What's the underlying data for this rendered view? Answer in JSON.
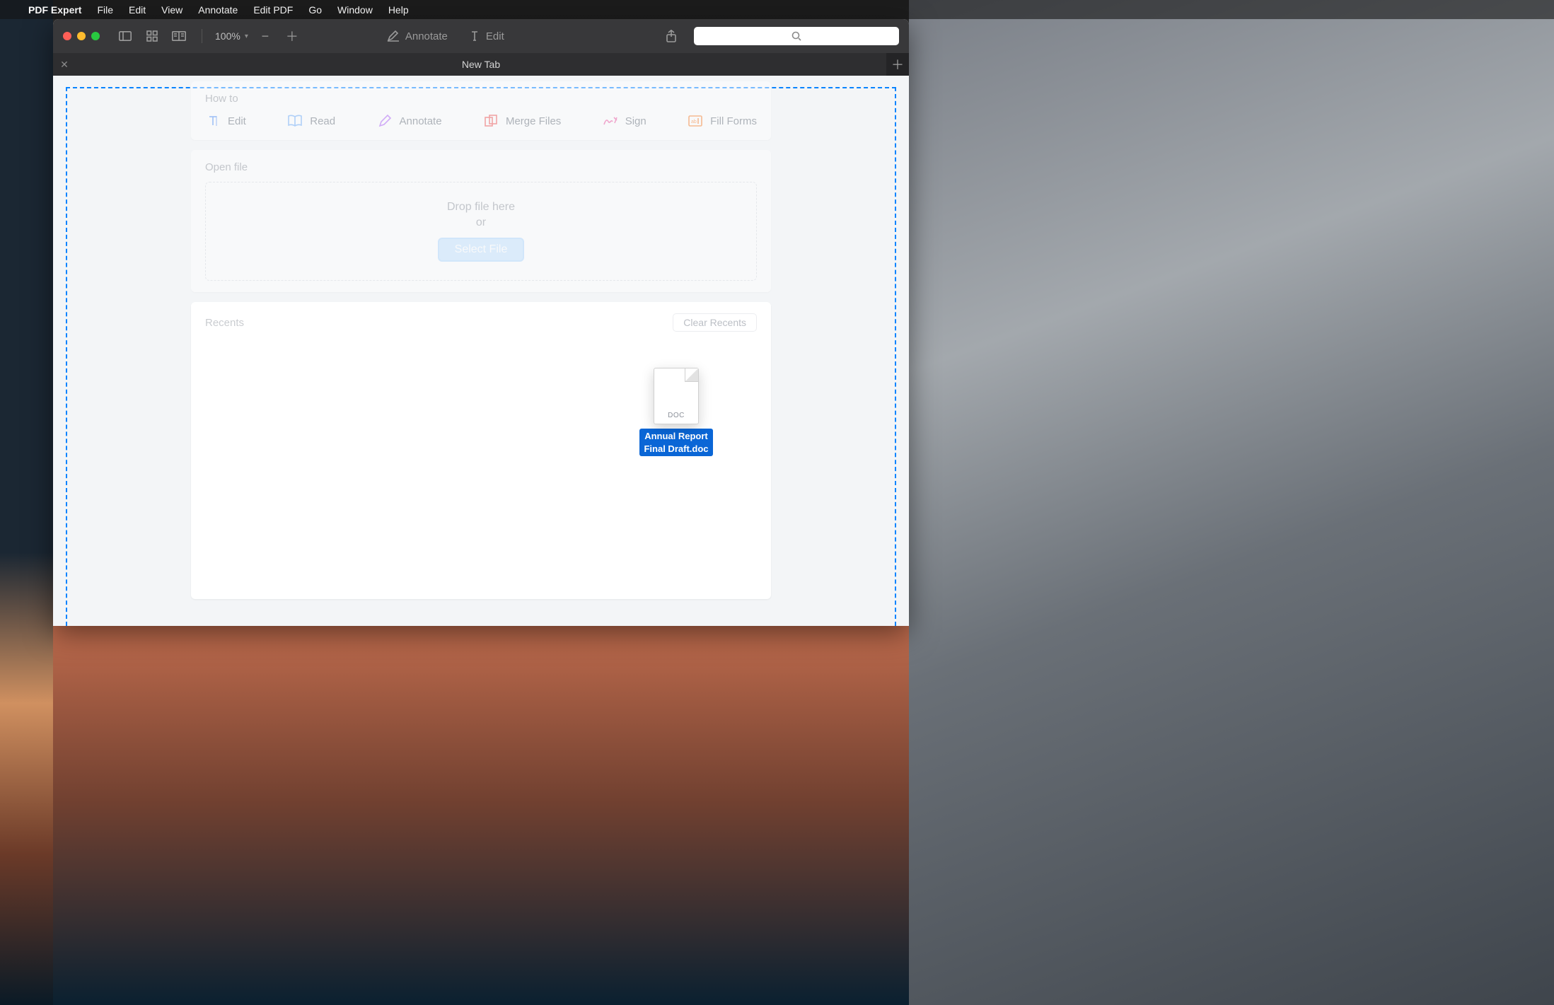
{
  "menubar": {
    "app_name": "PDF Expert",
    "items": [
      "File",
      "Edit",
      "View",
      "Annotate",
      "Edit PDF",
      "Go",
      "Window",
      "Help"
    ]
  },
  "toolbar": {
    "zoom_label": "100%",
    "annotate_label": "Annotate",
    "edit_label": "Edit"
  },
  "tabbar": {
    "title": "New Tab"
  },
  "howto": {
    "title": "How to",
    "items": [
      {
        "label": "Edit",
        "icon": "edit-text-icon",
        "color": "#3b82f6"
      },
      {
        "label": "Read",
        "icon": "book-icon",
        "color": "#60a5fa"
      },
      {
        "label": "Annotate",
        "icon": "pencil-icon",
        "color": "#a855f7"
      },
      {
        "label": "Merge Files",
        "icon": "merge-icon",
        "color": "#ef4444"
      },
      {
        "label": "Sign",
        "icon": "signature-icon",
        "color": "#ec4899"
      },
      {
        "label": "Fill Forms",
        "icon": "form-icon",
        "color": "#f97316"
      }
    ]
  },
  "openfile": {
    "title": "Open file",
    "drop_label": "Drop file here",
    "or_label": "or",
    "button_label": "Select File"
  },
  "recents": {
    "title": "Recents",
    "clear_label": "Clear Recents"
  },
  "dragged_file": {
    "extension": "DOC",
    "name_line1": "Annual Report",
    "name_line2": "Final Draft.doc"
  }
}
